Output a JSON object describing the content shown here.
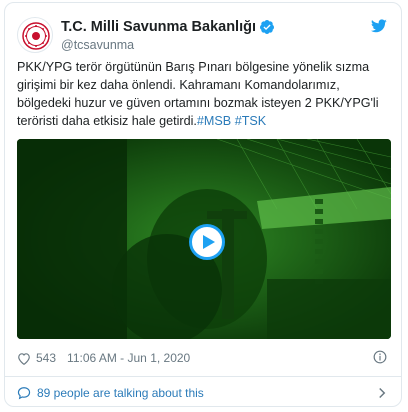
{
  "account": {
    "name": "T.C. Milli Savunma Bakanlığı",
    "handle": "@tcsavunma"
  },
  "tweet": {
    "text": "PKK/YPG terör örgütünün Barış Pınarı bölgesine yönelik sızma girişimi bir kez daha önlendi. Kahramanı Komandolarımız, bölgedeki huzur ve güven ortamını bozmak isteyen 2 PKK/YPG'li teröristi daha etkisiz hale getirdi.",
    "hashtag_1": "#MSB",
    "hashtag_2": "#TSK"
  },
  "stats": {
    "likes": "543",
    "timestamp": "11:06 AM - Jun 1, 2020"
  },
  "footer": {
    "talking_text": "89 people are talking about this"
  },
  "colors": {
    "brand_blue": "#1da1f2",
    "link_blue": "#2b7bb9",
    "media_green": "#0f4a0c",
    "text_dark": "#1c2022",
    "text_gray": "#697882"
  },
  "icons": {
    "verified": "verified-badge-icon",
    "twitter": "twitter-bird-icon",
    "like": "heart-icon",
    "info": "info-icon",
    "talking": "speech-bubble-icon",
    "chevron": "chevron-right-icon",
    "play": "play-icon"
  }
}
